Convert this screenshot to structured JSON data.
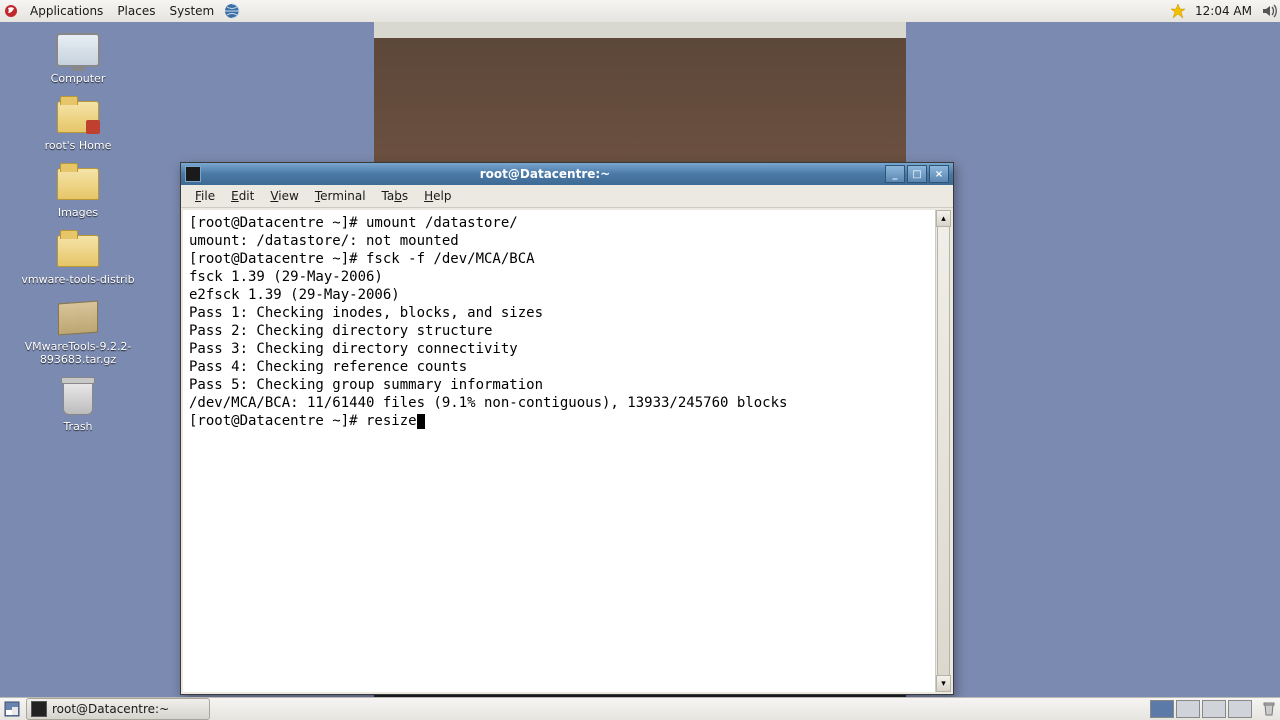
{
  "top_panel": {
    "menus": [
      "Applications",
      "Places",
      "System"
    ],
    "clock": "12:04 AM"
  },
  "desktop_icons": [
    {
      "id": "computer",
      "label": "Computer"
    },
    {
      "id": "home",
      "label": "root's Home"
    },
    {
      "id": "images",
      "label": "Images"
    },
    {
      "id": "vmware-dist",
      "label": "vmware-tools-distrib"
    },
    {
      "id": "vmware-tar",
      "label": "VMwareTools-9.2.2-893683.tar.gz"
    },
    {
      "id": "trash",
      "label": "Trash"
    }
  ],
  "window": {
    "title": "root@Datacentre:~",
    "menus": [
      {
        "label": "File",
        "u": "F"
      },
      {
        "label": "Edit",
        "u": "E"
      },
      {
        "label": "View",
        "u": "V"
      },
      {
        "label": "Terminal",
        "u": "T"
      },
      {
        "label": "Tabs",
        "u": "b"
      },
      {
        "label": "Help",
        "u": "H"
      }
    ],
    "buttons": {
      "min": "_",
      "max": "□",
      "close": "×"
    }
  },
  "terminal": {
    "lines": [
      "[root@Datacentre ~]# umount /datastore/",
      "umount: /datastore/: not mounted",
      "[root@Datacentre ~]# fsck -f /dev/MCA/BCA",
      "fsck 1.39 (29-May-2006)",
      "e2fsck 1.39 (29-May-2006)",
      "Pass 1: Checking inodes, blocks, and sizes",
      "Pass 2: Checking directory structure",
      "Pass 3: Checking directory connectivity",
      "Pass 4: Checking reference counts",
      "Pass 5: Checking group summary information",
      "/dev/MCA/BCA: 11/61440 files (9.1% non-contiguous), 13933/245760 blocks"
    ],
    "prompt": "[root@Datacentre ~]# ",
    "current_input": "resize"
  },
  "taskbar": {
    "task_label": "root@Datacentre:~"
  }
}
